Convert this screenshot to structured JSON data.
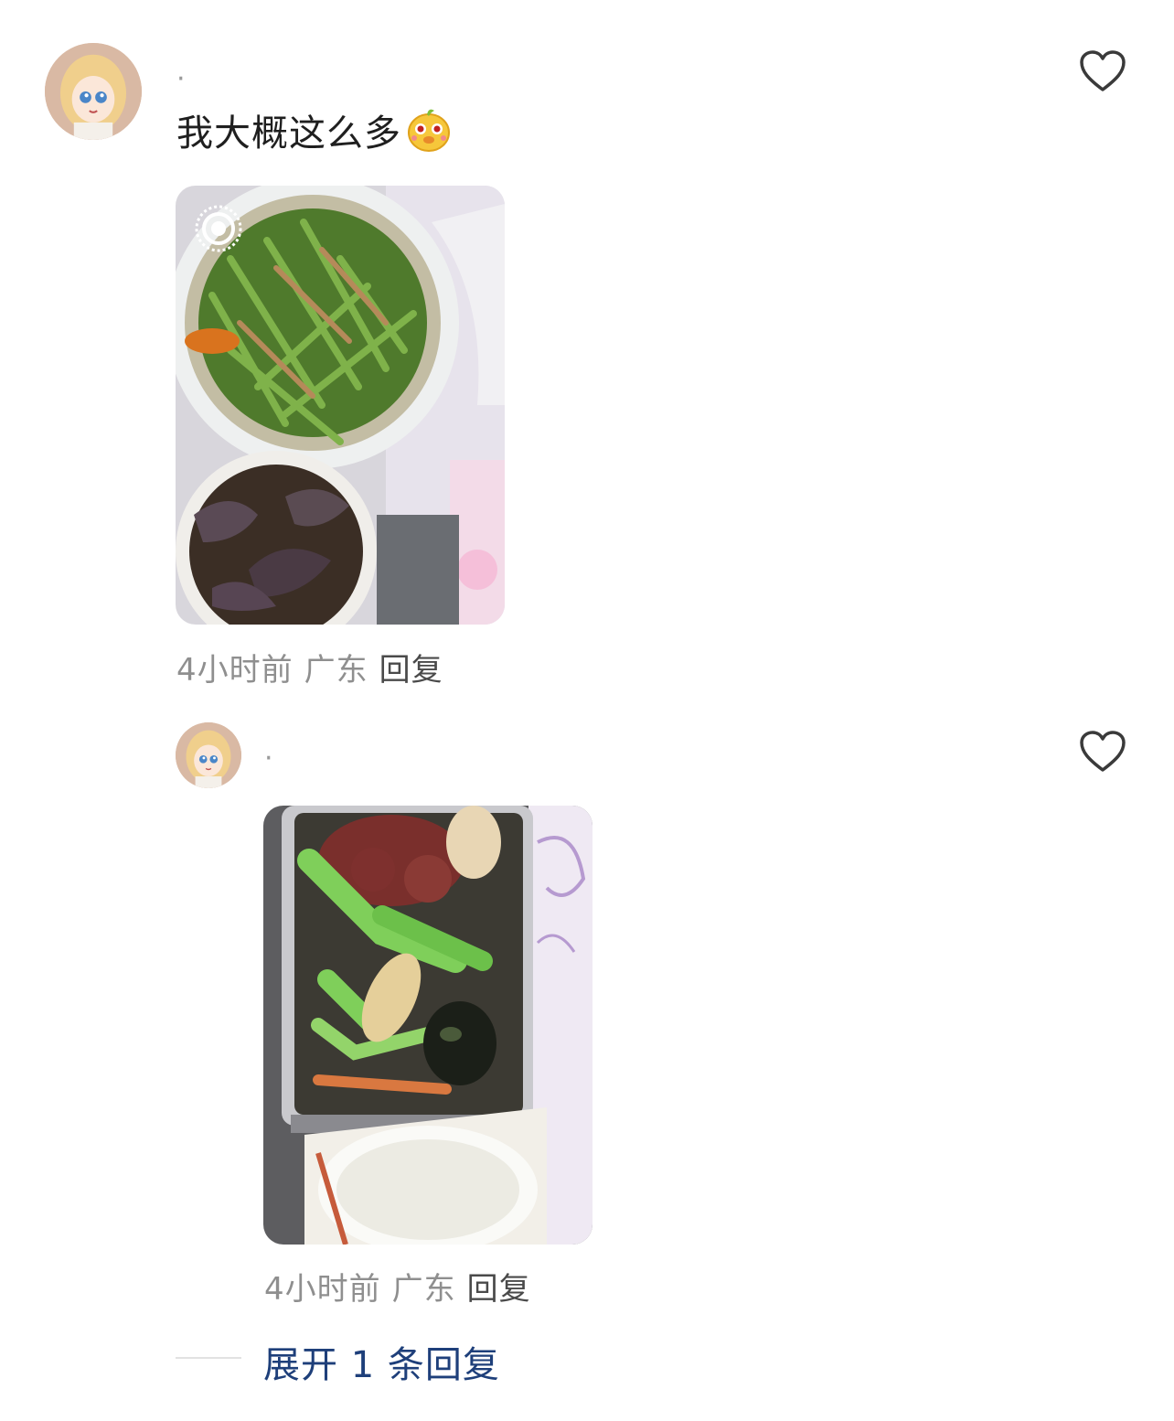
{
  "comments": [
    {
      "username": "·",
      "text": "我大概这么多",
      "emoji": "hamster-face-emoji",
      "time": "4小时前",
      "location": "广东",
      "reply_label": "回复",
      "photo_icon": "live-photo-icon"
    },
    {
      "username": "·",
      "time": "4小时前",
      "location": "广东",
      "reply_label": "回复"
    }
  ],
  "expand_label": "展开 1 条回复",
  "colors": {
    "meta_gray": "#8f8f8f",
    "link_blue": "#1e3f7a",
    "heart_stroke": "#3a3a3a"
  }
}
